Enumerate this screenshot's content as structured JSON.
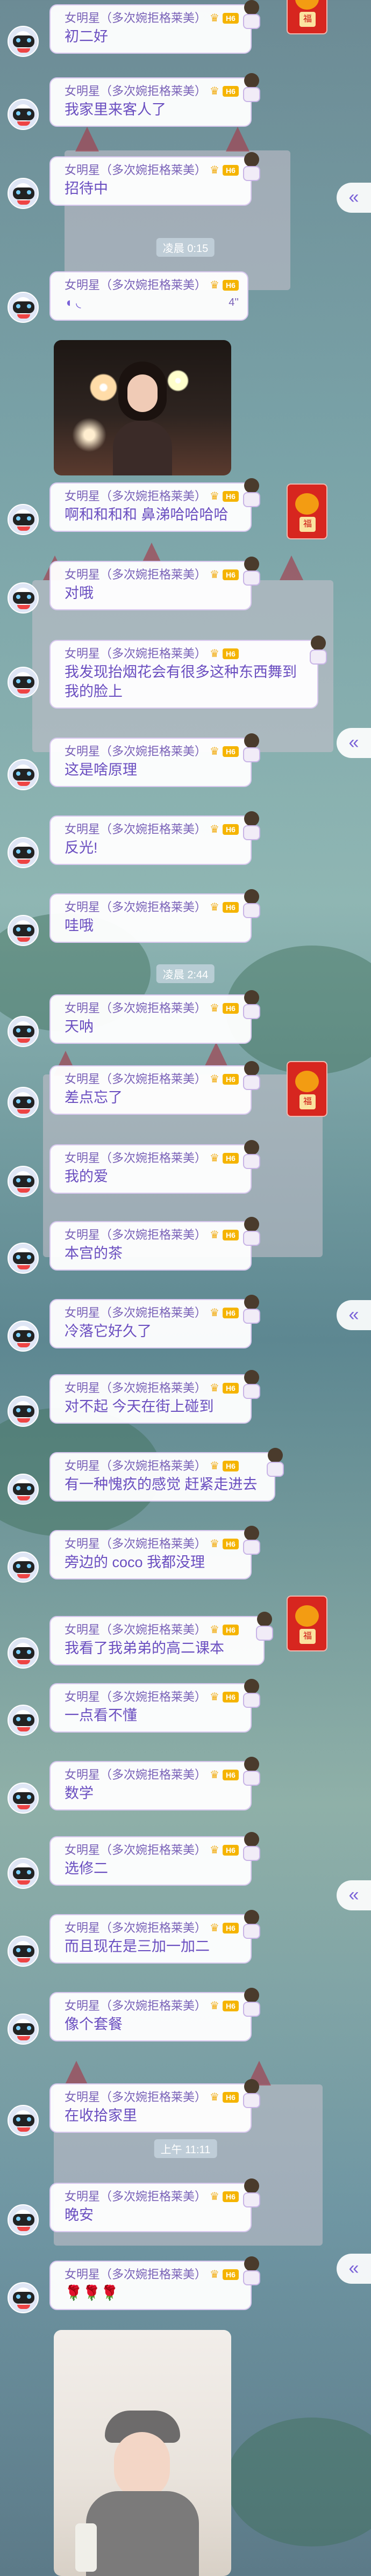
{
  "sender": {
    "name": "女明星（多次婉拒格莱美）",
    "level": "H6"
  },
  "messages": [
    {
      "text": "初二好"
    },
    {
      "text": "我家里来客人了"
    },
    {
      "text": "招待中"
    },
    {
      "text": "啊和和和和 鼻涕哈哈哈哈"
    },
    {
      "text": "对哦"
    },
    {
      "text": "我发现抬烟花会有很多这种东西舞到我的脸上"
    },
    {
      "text": "这是啥原理"
    },
    {
      "text": "反光!"
    },
    {
      "text": "哇哦"
    },
    {
      "text": "天呐"
    },
    {
      "text": "差点忘了"
    },
    {
      "text": "我的爱"
    },
    {
      "text": "本宫的茶"
    },
    {
      "text": "冷落它好久了"
    },
    {
      "text": "对不起 今天在街上碰到"
    },
    {
      "text": "有一种愧疚的感觉 赶紧走进去"
    },
    {
      "text": "旁边的 coco 我都没理"
    },
    {
      "text": "我看了我弟弟的高二课本"
    },
    {
      "text": "一点看不懂"
    },
    {
      "text": "数学"
    },
    {
      "text": "选修二"
    },
    {
      "text": "而且现在是三加一加二"
    },
    {
      "text": "像个套餐"
    },
    {
      "text": "在收拾家里"
    },
    {
      "text": "晚安"
    },
    {
      "text": "🌹🌹🌹"
    }
  ],
  "voice": {
    "duration": "4''"
  },
  "timestamps": {
    "t1": "凌晨 0:15",
    "t2": "凌晨 2:44",
    "t3": "上午 11:11"
  },
  "redpack_tag": "福",
  "side_button": "«"
}
